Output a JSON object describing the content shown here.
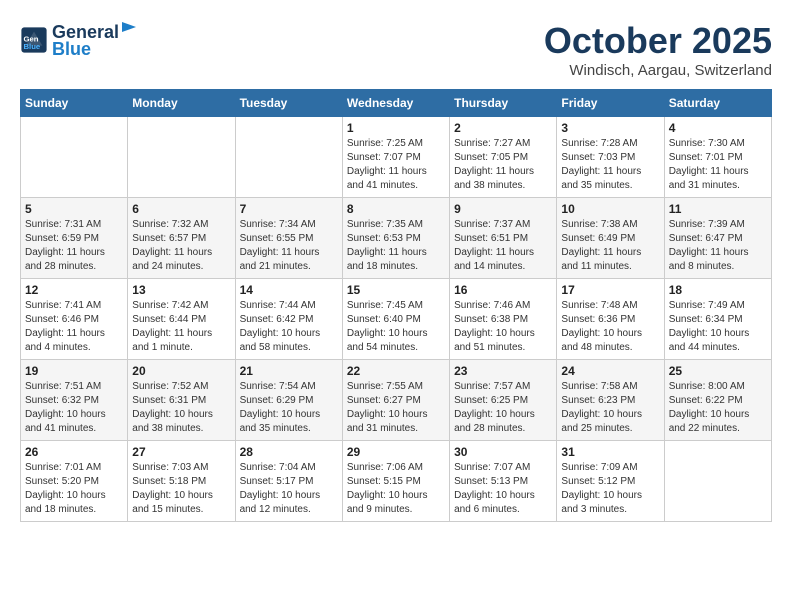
{
  "header": {
    "logo_line1": "General",
    "logo_line2": "Blue",
    "month": "October 2025",
    "location": "Windisch, Aargau, Switzerland"
  },
  "weekdays": [
    "Sunday",
    "Monday",
    "Tuesday",
    "Wednesday",
    "Thursday",
    "Friday",
    "Saturday"
  ],
  "weeks": [
    [
      {
        "day": "",
        "info": ""
      },
      {
        "day": "",
        "info": ""
      },
      {
        "day": "",
        "info": ""
      },
      {
        "day": "1",
        "info": "Sunrise: 7:25 AM\nSunset: 7:07 PM\nDaylight: 11 hours\nand 41 minutes."
      },
      {
        "day": "2",
        "info": "Sunrise: 7:27 AM\nSunset: 7:05 PM\nDaylight: 11 hours\nand 38 minutes."
      },
      {
        "day": "3",
        "info": "Sunrise: 7:28 AM\nSunset: 7:03 PM\nDaylight: 11 hours\nand 35 minutes."
      },
      {
        "day": "4",
        "info": "Sunrise: 7:30 AM\nSunset: 7:01 PM\nDaylight: 11 hours\nand 31 minutes."
      }
    ],
    [
      {
        "day": "5",
        "info": "Sunrise: 7:31 AM\nSunset: 6:59 PM\nDaylight: 11 hours\nand 28 minutes."
      },
      {
        "day": "6",
        "info": "Sunrise: 7:32 AM\nSunset: 6:57 PM\nDaylight: 11 hours\nand 24 minutes."
      },
      {
        "day": "7",
        "info": "Sunrise: 7:34 AM\nSunset: 6:55 PM\nDaylight: 11 hours\nand 21 minutes."
      },
      {
        "day": "8",
        "info": "Sunrise: 7:35 AM\nSunset: 6:53 PM\nDaylight: 11 hours\nand 18 minutes."
      },
      {
        "day": "9",
        "info": "Sunrise: 7:37 AM\nSunset: 6:51 PM\nDaylight: 11 hours\nand 14 minutes."
      },
      {
        "day": "10",
        "info": "Sunrise: 7:38 AM\nSunset: 6:49 PM\nDaylight: 11 hours\nand 11 minutes."
      },
      {
        "day": "11",
        "info": "Sunrise: 7:39 AM\nSunset: 6:47 PM\nDaylight: 11 hours\nand 8 minutes."
      }
    ],
    [
      {
        "day": "12",
        "info": "Sunrise: 7:41 AM\nSunset: 6:46 PM\nDaylight: 11 hours\nand 4 minutes."
      },
      {
        "day": "13",
        "info": "Sunrise: 7:42 AM\nSunset: 6:44 PM\nDaylight: 11 hours\nand 1 minute."
      },
      {
        "day": "14",
        "info": "Sunrise: 7:44 AM\nSunset: 6:42 PM\nDaylight: 10 hours\nand 58 minutes."
      },
      {
        "day": "15",
        "info": "Sunrise: 7:45 AM\nSunset: 6:40 PM\nDaylight: 10 hours\nand 54 minutes."
      },
      {
        "day": "16",
        "info": "Sunrise: 7:46 AM\nSunset: 6:38 PM\nDaylight: 10 hours\nand 51 minutes."
      },
      {
        "day": "17",
        "info": "Sunrise: 7:48 AM\nSunset: 6:36 PM\nDaylight: 10 hours\nand 48 minutes."
      },
      {
        "day": "18",
        "info": "Sunrise: 7:49 AM\nSunset: 6:34 PM\nDaylight: 10 hours\nand 44 minutes."
      }
    ],
    [
      {
        "day": "19",
        "info": "Sunrise: 7:51 AM\nSunset: 6:32 PM\nDaylight: 10 hours\nand 41 minutes."
      },
      {
        "day": "20",
        "info": "Sunrise: 7:52 AM\nSunset: 6:31 PM\nDaylight: 10 hours\nand 38 minutes."
      },
      {
        "day": "21",
        "info": "Sunrise: 7:54 AM\nSunset: 6:29 PM\nDaylight: 10 hours\nand 35 minutes."
      },
      {
        "day": "22",
        "info": "Sunrise: 7:55 AM\nSunset: 6:27 PM\nDaylight: 10 hours\nand 31 minutes."
      },
      {
        "day": "23",
        "info": "Sunrise: 7:57 AM\nSunset: 6:25 PM\nDaylight: 10 hours\nand 28 minutes."
      },
      {
        "day": "24",
        "info": "Sunrise: 7:58 AM\nSunset: 6:23 PM\nDaylight: 10 hours\nand 25 minutes."
      },
      {
        "day": "25",
        "info": "Sunrise: 8:00 AM\nSunset: 6:22 PM\nDaylight: 10 hours\nand 22 minutes."
      }
    ],
    [
      {
        "day": "26",
        "info": "Sunrise: 7:01 AM\nSunset: 5:20 PM\nDaylight: 10 hours\nand 18 minutes."
      },
      {
        "day": "27",
        "info": "Sunrise: 7:03 AM\nSunset: 5:18 PM\nDaylight: 10 hours\nand 15 minutes."
      },
      {
        "day": "28",
        "info": "Sunrise: 7:04 AM\nSunset: 5:17 PM\nDaylight: 10 hours\nand 12 minutes."
      },
      {
        "day": "29",
        "info": "Sunrise: 7:06 AM\nSunset: 5:15 PM\nDaylight: 10 hours\nand 9 minutes."
      },
      {
        "day": "30",
        "info": "Sunrise: 7:07 AM\nSunset: 5:13 PM\nDaylight: 10 hours\nand 6 minutes."
      },
      {
        "day": "31",
        "info": "Sunrise: 7:09 AM\nSunset: 5:12 PM\nDaylight: 10 hours\nand 3 minutes."
      },
      {
        "day": "",
        "info": ""
      }
    ]
  ]
}
